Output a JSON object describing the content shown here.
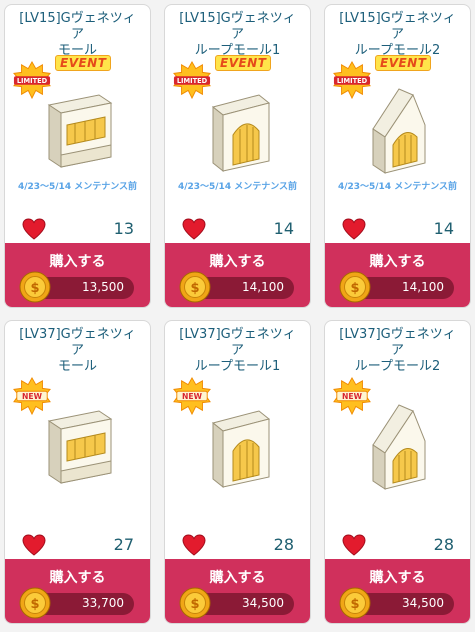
{
  "cards": [
    {
      "title_l1": "[LV15]Gヴェネツィ",
      "title_l2": "ア",
      "title_l3": "モール",
      "badge": "LIMITED",
      "event": "EVENT",
      "date": "4/23～5/14 メンテナンス前",
      "likes": "13",
      "buy": "購入する",
      "price": "13,500"
    },
    {
      "title_l1": "[LV15]Gヴェネツィ",
      "title_l2": "ア",
      "title_l3": "ループモール1",
      "badge": "LIMITED",
      "event": "EVENT",
      "date": "4/23～5/14 メンテナンス前",
      "likes": "14",
      "buy": "購入する",
      "price": "14,100"
    },
    {
      "title_l1": "[LV15]Gヴェネツィ",
      "title_l2": "ア",
      "title_l3": "ループモール2",
      "badge": "LIMITED",
      "event": "EVENT",
      "date": "4/23～5/14 メンテナンス前",
      "likes": "14",
      "buy": "購入する",
      "price": "14,100"
    },
    {
      "title_l1": "[LV37]Gヴェネツィ",
      "title_l2": "ア",
      "title_l3": "モール",
      "badge": "NEW",
      "likes": "27",
      "buy": "購入する",
      "price": "33,700"
    },
    {
      "title_l1": "[LV37]Gヴェネツィ",
      "title_l2": "ア",
      "title_l3": "ループモール1",
      "badge": "NEW",
      "likes": "28",
      "buy": "購入する",
      "price": "34,500"
    },
    {
      "title_l1": "[LV37]Gヴェネツィ",
      "title_l2": "ア",
      "title_l3": "ループモール2",
      "badge": "NEW",
      "likes": "28",
      "buy": "購入する",
      "price": "34,500"
    }
  ]
}
